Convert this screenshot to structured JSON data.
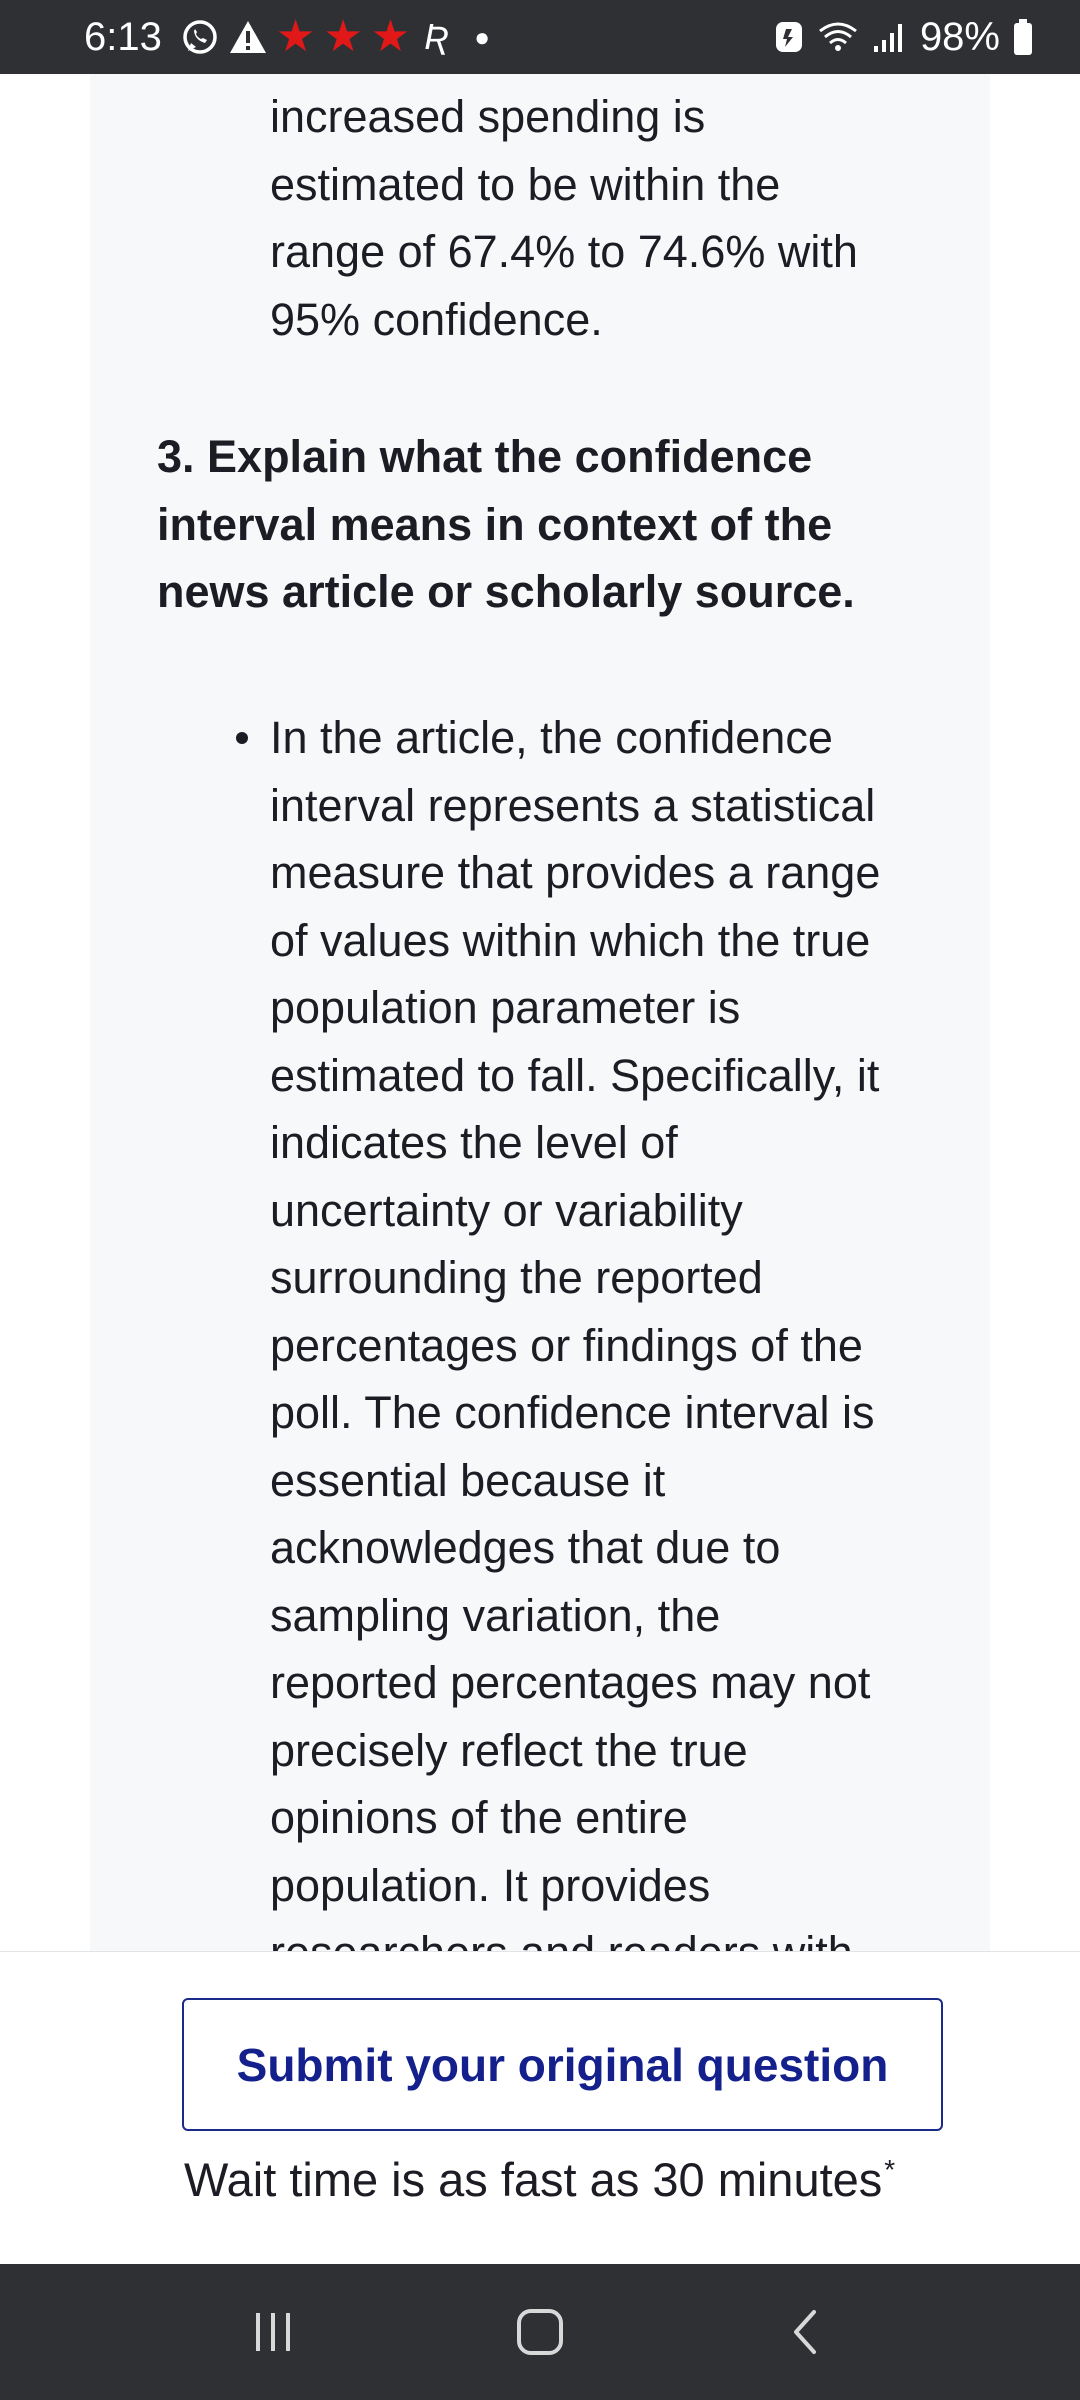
{
  "status_bar": {
    "time": "6:13",
    "battery": "98%",
    "icons": [
      "whatsapp-icon",
      "warning-icon",
      "star-icon",
      "star-icon",
      "star-icon",
      "r-app-icon",
      "dot-icon",
      "battery-saver-icon",
      "wifi-icon",
      "signal-icon",
      "battery-icon"
    ],
    "star_color": "#e01818"
  },
  "content": {
    "partial_top_lines": [
      "increased spending is",
      "estimated to be within the",
      "range of 67.4% to 74.6% with",
      "95% confidence."
    ],
    "heading_lines": [
      "3. Explain what the confidence",
      "interval means in context of the",
      "news article or scholarly source."
    ],
    "bullet_lines": [
      "In the article, the confidence",
      "interval represents a statistical",
      "measure that provides a range",
      "of values within which the true",
      "population parameter is",
      "estimated to fall. Specifically, it",
      "indicates the level of",
      "uncertainty or variability",
      "surrounding the reported",
      "percentages or findings of the",
      "poll. The confidence interval is",
      "essential because it",
      "acknowledges that due to",
      "sampling variation, the",
      "reported percentages may not",
      "precisely reflect the true",
      "opinions of the entire",
      "population. It provides",
      "researchers and readers with"
    ]
  },
  "cta": {
    "button_label": "Submit your original question",
    "wait_text": "Wait time is as fast as 30 minutes",
    "asterisk": "*",
    "accent_color": "#14208c"
  },
  "nav_bar": {
    "buttons": [
      "recents-button",
      "home-button",
      "back-button"
    ]
  }
}
